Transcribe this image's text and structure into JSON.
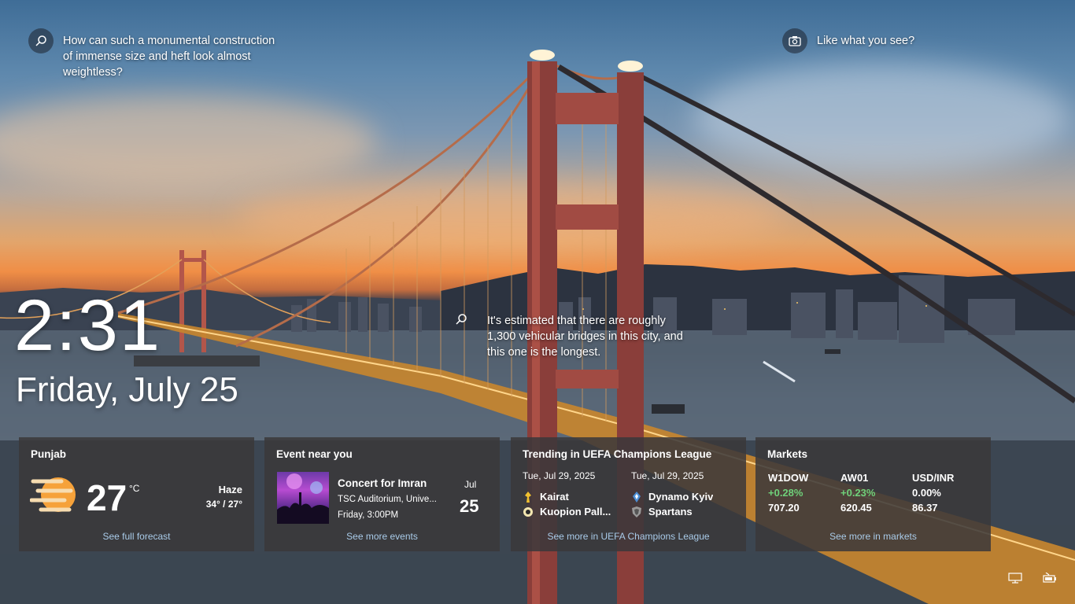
{
  "spotlight": {
    "left_question": "How can such a monumental construction of immense size and heft look almost weightless?",
    "right_prompt": "Like what you see?",
    "mid_fact": "It's estimated that there are roughly 1,300 vehicular bridges in this city, and this one is the longest."
  },
  "clock": {
    "time": "2:31",
    "date": "Friday, July 25"
  },
  "weather": {
    "location": "Punjab",
    "temp": "27",
    "unit": "°C",
    "condition": "Haze",
    "range": "34° / 27°",
    "link": "See full forecast",
    "icon": "haze-sun-icon"
  },
  "event": {
    "title": "Event near you",
    "name": "Concert for Imran",
    "venue": "TSC Auditorium, Unive...",
    "time": "Friday, 3:00PM",
    "month": "Jul",
    "day": "25",
    "link": "See more events"
  },
  "trending": {
    "title": "Trending in UEFA Champions League",
    "matches": [
      {
        "date": "Tue, Jul 29, 2025",
        "team1": "Kairat",
        "team2": "Kuopion Pall..."
      },
      {
        "date": "Tue, Jul 29, 2025",
        "team1": "Dynamo Kyiv",
        "team2": "Spartans"
      }
    ],
    "link": "See more in UEFA Champions League"
  },
  "markets": {
    "title": "Markets",
    "items": [
      {
        "symbol": "W1DOW",
        "change": "+0.28%",
        "value": "707.20",
        "direction": "up"
      },
      {
        "symbol": "AW01",
        "change": "+0.23%",
        "value": "620.45",
        "direction": "up"
      },
      {
        "symbol": "USD/INR",
        "change": "0.00%",
        "value": "86.37",
        "direction": "flat"
      }
    ],
    "link": "See more in markets"
  },
  "tray": {
    "icons": [
      "network-icon",
      "battery-icon"
    ]
  },
  "colors": {
    "link": "#a9cbe9",
    "up": "#6fd17a",
    "card_bg": "#3a383a"
  }
}
